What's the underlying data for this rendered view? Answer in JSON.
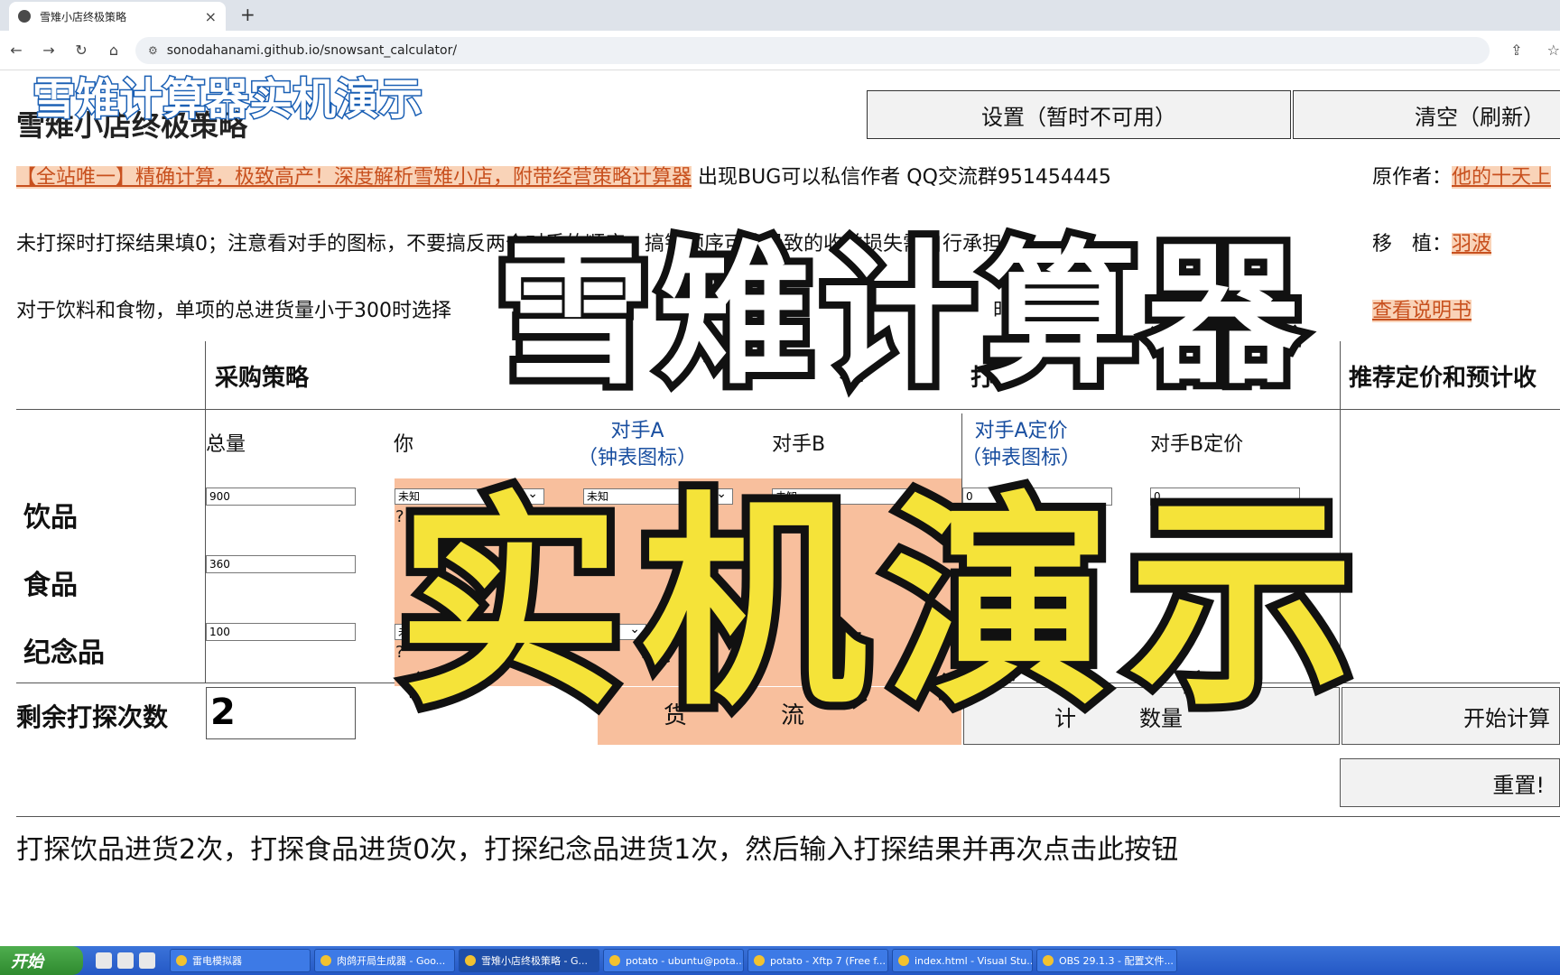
{
  "browser": {
    "tab_title": "雪雉小店终极策略",
    "tab_close": "×",
    "new_tab": "+",
    "url": "sonodahanami.github.io/snowsant_calculator/",
    "nav": {
      "back": "←",
      "forward": "→",
      "reload": "↻",
      "home": "⌂"
    },
    "icons": {
      "share": "⇪",
      "star": "☆"
    }
  },
  "header": {
    "title": "雪雉小店终极策略",
    "settings_button": "设置（暂时不可用）",
    "clear_button": "清空（刷新）"
  },
  "info": {
    "banner_link": "【全站唯一】精确计算，极致高产！深度解析雪雉小店，附带经营策略计算器",
    "banner_tail": "出现BUG可以私信作者 QQ交流群951454445",
    "author_label": "原作者：",
    "author_name": "他的十天上",
    "porter_label": "移　植：",
    "porter_name": "羽波",
    "manual_link": "查看说明书",
    "line2": "未打探时打探结果填0；注意看对手的图标，不要搞反两个对手的顺序，搞错顺序可能导致的收益损失需自行承担",
    "line3_start": "对于饮料和食物，单项的总进货量小于300时选择",
    "line3_end": "时",
    "line3_tail": "品"
  },
  "table": {
    "section_purchase": "采购策略",
    "section_scout": "打",
    "section_recommend": "推荐定价和预计收",
    "col_total": "总量",
    "col_you": "你",
    "col_rival_a": "对手A",
    "col_rival_a_sub": "（钟表图标）",
    "col_rival_b": "对手B",
    "col_price_a": "对手A定价",
    "col_price_a_sub": "（钟表图标）",
    "col_price_b": "对手B定价",
    "rows": [
      {
        "label": "饮品",
        "total": "900",
        "you": "未知",
        "a": "未知",
        "b": "未知",
        "price_a": "0",
        "price_b": "0"
      },
      {
        "label": "食品",
        "total": "360",
        "price_b": "0"
      },
      {
        "label": "纪念品",
        "total": "100",
        "you": "未知",
        "a": "未知"
      }
    ],
    "q": "?"
  },
  "remaining": {
    "label": "剩余打探次数",
    "value": "2",
    "btn_left_1": "货",
    "btn_left_2": "流",
    "btn_mid": "计",
    "btn_mid_2": "数量",
    "start_button": "开始计算",
    "reset_button": "重置!"
  },
  "result_text": "打探饮品进货2次，打探食品进货0次，打探纪念品进货1次，然后输入打探结果并再次点击此按钮",
  "overlay": {
    "top": "雪雉计算器实机演示",
    "big1": "雪雉计算器",
    "big2": "实机演示"
  },
  "taskbar": {
    "start": "开始",
    "items": [
      "雷电模拟器",
      "肉鸽开局生成器 - Goo...",
      "雪雉小店终极策略 - G...",
      "potato - ubuntu@pota...",
      "potato - Xftp 7 (Free f...",
      "index.html - Visual Stu...",
      "OBS 29.1.3 - 配置文件..."
    ]
  }
}
